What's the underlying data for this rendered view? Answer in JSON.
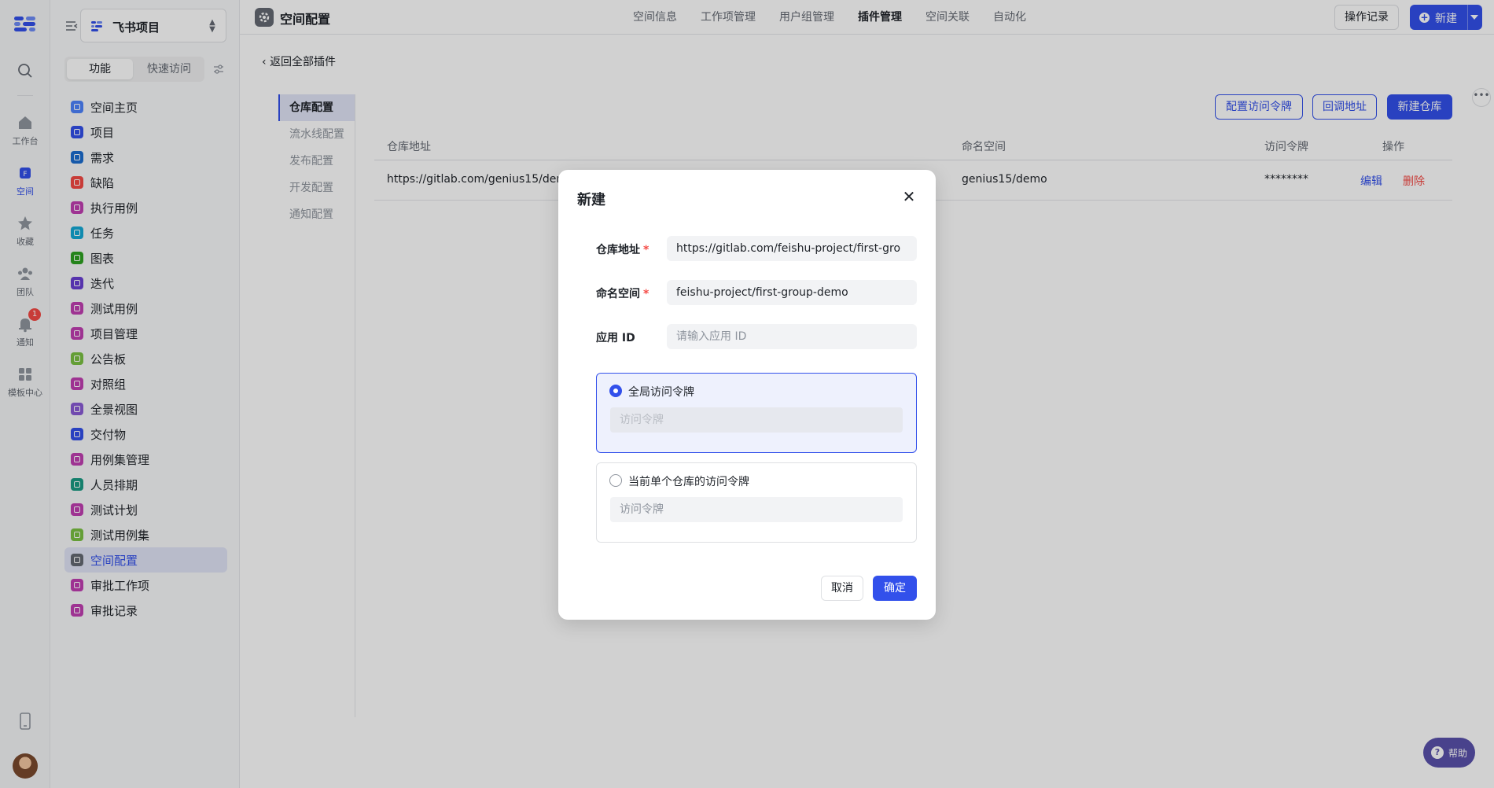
{
  "rail": {
    "items": [
      {
        "label": "工作台"
      },
      {
        "label": "空间"
      },
      {
        "label": "收藏"
      },
      {
        "label": "团队"
      },
      {
        "label": "通知"
      },
      {
        "label": "模板中心"
      }
    ],
    "notify_badge": "1"
  },
  "sidebar": {
    "project_name": "飞书项目",
    "seg": [
      "功能",
      "快速访问"
    ],
    "items": [
      {
        "label": "空间主页",
        "color": "#4e83fd"
      },
      {
        "label": "项目",
        "color": "#3250eb"
      },
      {
        "label": "需求",
        "color": "#1c6dd0"
      },
      {
        "label": "缺陷",
        "color": "#f54a45"
      },
      {
        "label": "执行用例",
        "color": "#c13fb2"
      },
      {
        "label": "任务",
        "color": "#14a9d6"
      },
      {
        "label": "图表",
        "color": "#2ea121"
      },
      {
        "label": "迭代",
        "color": "#6a3fd4"
      },
      {
        "label": "测试用例",
        "color": "#c13fb2"
      },
      {
        "label": "项目管理",
        "color": "#c13fb2"
      },
      {
        "label": "公告板",
        "color": "#7ac142"
      },
      {
        "label": "对照组",
        "color": "#c13fb2"
      },
      {
        "label": "全景视图",
        "color": "#8a5bd6"
      },
      {
        "label": "交付物",
        "color": "#3250eb"
      },
      {
        "label": "用例集管理",
        "color": "#c13fb2"
      },
      {
        "label": "人员排期",
        "color": "#1a9c84"
      },
      {
        "label": "测试计划",
        "color": "#c13fb2"
      },
      {
        "label": "测试用例集",
        "color": "#7ac142"
      },
      {
        "label": "空间配置",
        "color": "#646a73"
      },
      {
        "label": "审批工作项",
        "color": "#c13fb2"
      },
      {
        "label": "审批记录",
        "color": "#c13fb2"
      }
    ],
    "active_index": 18
  },
  "topbar": {
    "title": "空间配置",
    "tabs": [
      "空间信息",
      "工作项管理",
      "用户组管理",
      "插件管理",
      "空间关联",
      "自动化"
    ],
    "active_tab": 3,
    "log_btn": "操作记录",
    "new_btn": "新建"
  },
  "content": {
    "back": "返回全部插件",
    "subnav": [
      "仓库配置",
      "流水线配置",
      "发布配置",
      "开发配置",
      "通知配置"
    ],
    "actions": {
      "token": "配置访问令牌",
      "callback": "回调地址",
      "new_repo": "新建仓库"
    },
    "table": {
      "headers": [
        "仓库地址",
        "命名空间",
        "访问令牌",
        "操作"
      ],
      "rows": [
        {
          "address": "https://gitlab.com/genius15/demo",
          "namespace": "genius15/demo",
          "token": "********",
          "edit": "编辑",
          "delete": "删除"
        }
      ]
    }
  },
  "modal": {
    "title": "新建",
    "fields": {
      "address_label": "仓库地址",
      "address_value": "https://gitlab.com/feishu-project/first-gro",
      "namespace_label": "命名空间",
      "namespace_value": "feishu-project/first-group-demo",
      "appid_label": "应用 ID",
      "appid_placeholder": "请输入应用 ID"
    },
    "options": [
      {
        "label": "全局访问令牌",
        "placeholder": "访问令牌",
        "selected": true
      },
      {
        "label": "当前单个仓库的访问令牌",
        "placeholder": "访问令牌",
        "selected": false
      }
    ],
    "cancel": "取消",
    "confirm": "确定"
  },
  "help": "帮助",
  "colors": {
    "accent": "#3250eb",
    "danger": "#f54a45"
  }
}
